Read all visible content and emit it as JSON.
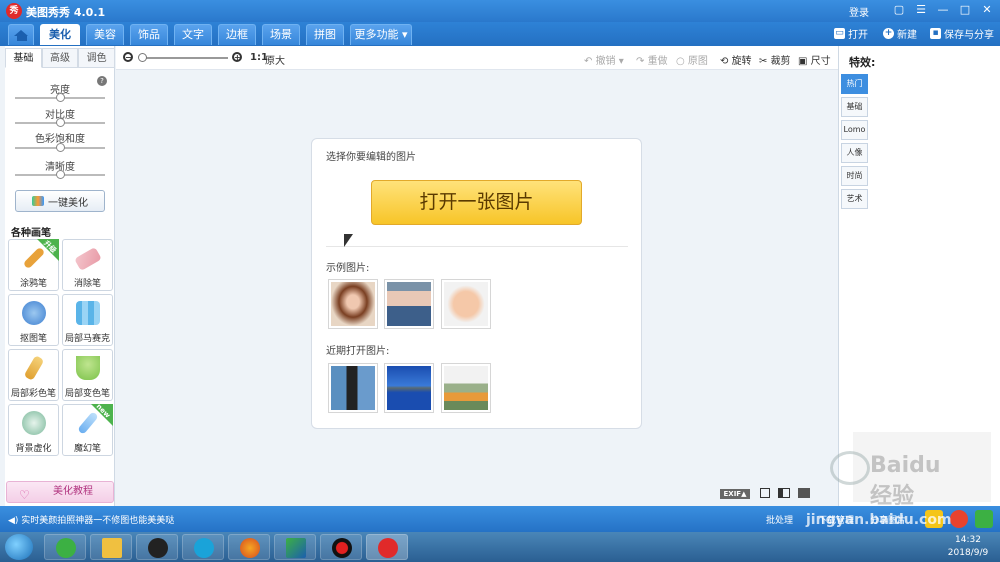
{
  "app": {
    "title": "美图秀秀 4.0.1",
    "logo_text": "秀",
    "login": "登录"
  },
  "window_controls": {
    "skin": "▢",
    "menu": "☰",
    "minimize": "—",
    "maximize": "□",
    "close": "✕"
  },
  "tabs": [
    {
      "label": "美化",
      "active": true
    },
    {
      "label": "美容"
    },
    {
      "label": "饰品"
    },
    {
      "label": "文字"
    },
    {
      "label": "边框"
    },
    {
      "label": "场景"
    },
    {
      "label": "拼图"
    },
    {
      "label": "更多功能 ▾"
    }
  ],
  "top_actions": {
    "open": "打开",
    "new": "新建",
    "save_share": "保存与分享"
  },
  "left_panel": {
    "subtabs": [
      "基础",
      "高级",
      "调色"
    ],
    "sliders": [
      {
        "label": "亮度",
        "value": 0.5
      },
      {
        "label": "对比度",
        "value": 0.5
      },
      {
        "label": "色彩饱和度",
        "value": 0.5
      },
      {
        "label": "清晰度",
        "value": 0.5
      }
    ],
    "one_click": "一键美化",
    "section_title": "各种画笔",
    "tools": [
      {
        "label": "涂鸦笔",
        "badge": "升级",
        "color": "#e8a23a"
      },
      {
        "label": "消除笔",
        "color": "#e89aa6"
      },
      {
        "label": "抠图笔",
        "color": "#3d7fd0"
      },
      {
        "label": "局部马赛克",
        "color": "#5ab4e8"
      },
      {
        "label": "局部彩色笔",
        "color": "#e0a030"
      },
      {
        "label": "局部变色笔",
        "color": "#7cc24a"
      },
      {
        "label": "背景虚化",
        "color": "#7ab89a"
      },
      {
        "label": "魔幻笔",
        "badge": "new",
        "color": "#6aaef0"
      }
    ],
    "tutorial": "美化教程"
  },
  "image_toolbar": {
    "ratio": "1:1",
    "original": "原大",
    "undo": "撤销",
    "redo": "重做",
    "reset": "原图",
    "rotate": "旋转",
    "crop": "裁剪",
    "resize": "尺寸"
  },
  "open_panel": {
    "heading": "选择你要编辑的图片",
    "open_button": "打开一张图片",
    "samples_label": "示例图片:",
    "recent_label": "近期打开图片:"
  },
  "right_panel": {
    "title": "特效:",
    "tabs": [
      "热门",
      "基础",
      "Lomo",
      "人像",
      "时尚",
      "艺术"
    ]
  },
  "bottom_tools": {
    "exif": "EXIF▲"
  },
  "status_bar": {
    "message": "实时美颜拍照神器一不修图也能美美哒",
    "batch": "批处理",
    "download": "下载管理",
    "share": "分享图片"
  },
  "taskbar": {
    "time": "14:32",
    "date": "2018/9/9"
  },
  "watermark": {
    "text": "Baidu经验",
    "url": "jingyan.baidu.com"
  },
  "colors": {
    "accent": "#2a78cc",
    "button_yellow": "#f7c528",
    "active_tab": "#3d8ee0"
  }
}
